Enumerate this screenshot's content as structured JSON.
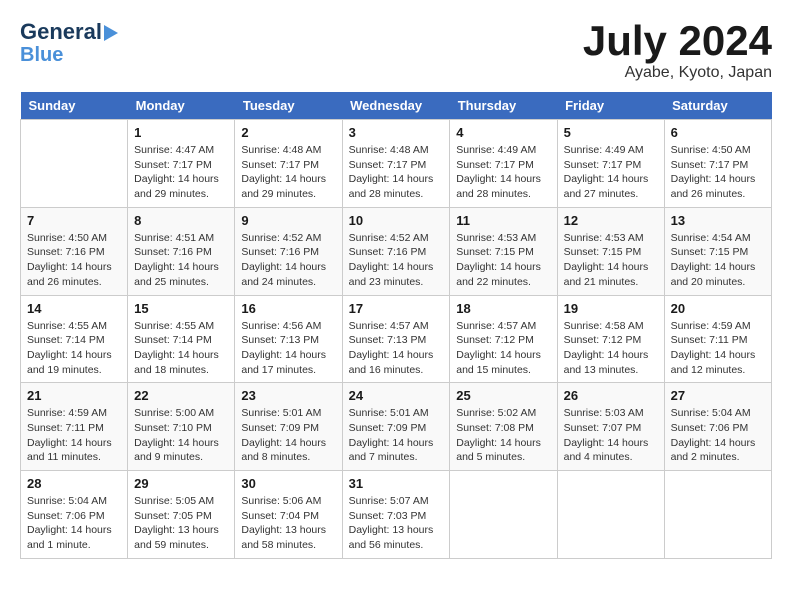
{
  "header": {
    "logo_line1": "General",
    "logo_line2": "Blue",
    "month": "July 2024",
    "location": "Ayabe, Kyoto, Japan"
  },
  "weekdays": [
    "Sunday",
    "Monday",
    "Tuesday",
    "Wednesday",
    "Thursday",
    "Friday",
    "Saturday"
  ],
  "weeks": [
    [
      {
        "day": "",
        "info": ""
      },
      {
        "day": "1",
        "info": "Sunrise: 4:47 AM\nSunset: 7:17 PM\nDaylight: 14 hours\nand 29 minutes."
      },
      {
        "day": "2",
        "info": "Sunrise: 4:48 AM\nSunset: 7:17 PM\nDaylight: 14 hours\nand 29 minutes."
      },
      {
        "day": "3",
        "info": "Sunrise: 4:48 AM\nSunset: 7:17 PM\nDaylight: 14 hours\nand 28 minutes."
      },
      {
        "day": "4",
        "info": "Sunrise: 4:49 AM\nSunset: 7:17 PM\nDaylight: 14 hours\nand 28 minutes."
      },
      {
        "day": "5",
        "info": "Sunrise: 4:49 AM\nSunset: 7:17 PM\nDaylight: 14 hours\nand 27 minutes."
      },
      {
        "day": "6",
        "info": "Sunrise: 4:50 AM\nSunset: 7:17 PM\nDaylight: 14 hours\nand 26 minutes."
      }
    ],
    [
      {
        "day": "7",
        "info": "Sunrise: 4:50 AM\nSunset: 7:16 PM\nDaylight: 14 hours\nand 26 minutes."
      },
      {
        "day": "8",
        "info": "Sunrise: 4:51 AM\nSunset: 7:16 PM\nDaylight: 14 hours\nand 25 minutes."
      },
      {
        "day": "9",
        "info": "Sunrise: 4:52 AM\nSunset: 7:16 PM\nDaylight: 14 hours\nand 24 minutes."
      },
      {
        "day": "10",
        "info": "Sunrise: 4:52 AM\nSunset: 7:16 PM\nDaylight: 14 hours\nand 23 minutes."
      },
      {
        "day": "11",
        "info": "Sunrise: 4:53 AM\nSunset: 7:15 PM\nDaylight: 14 hours\nand 22 minutes."
      },
      {
        "day": "12",
        "info": "Sunrise: 4:53 AM\nSunset: 7:15 PM\nDaylight: 14 hours\nand 21 minutes."
      },
      {
        "day": "13",
        "info": "Sunrise: 4:54 AM\nSunset: 7:15 PM\nDaylight: 14 hours\nand 20 minutes."
      }
    ],
    [
      {
        "day": "14",
        "info": "Sunrise: 4:55 AM\nSunset: 7:14 PM\nDaylight: 14 hours\nand 19 minutes."
      },
      {
        "day": "15",
        "info": "Sunrise: 4:55 AM\nSunset: 7:14 PM\nDaylight: 14 hours\nand 18 minutes."
      },
      {
        "day": "16",
        "info": "Sunrise: 4:56 AM\nSunset: 7:13 PM\nDaylight: 14 hours\nand 17 minutes."
      },
      {
        "day": "17",
        "info": "Sunrise: 4:57 AM\nSunset: 7:13 PM\nDaylight: 14 hours\nand 16 minutes."
      },
      {
        "day": "18",
        "info": "Sunrise: 4:57 AM\nSunset: 7:12 PM\nDaylight: 14 hours\nand 15 minutes."
      },
      {
        "day": "19",
        "info": "Sunrise: 4:58 AM\nSunset: 7:12 PM\nDaylight: 14 hours\nand 13 minutes."
      },
      {
        "day": "20",
        "info": "Sunrise: 4:59 AM\nSunset: 7:11 PM\nDaylight: 14 hours\nand 12 minutes."
      }
    ],
    [
      {
        "day": "21",
        "info": "Sunrise: 4:59 AM\nSunset: 7:11 PM\nDaylight: 14 hours\nand 11 minutes."
      },
      {
        "day": "22",
        "info": "Sunrise: 5:00 AM\nSunset: 7:10 PM\nDaylight: 14 hours\nand 9 minutes."
      },
      {
        "day": "23",
        "info": "Sunrise: 5:01 AM\nSunset: 7:09 PM\nDaylight: 14 hours\nand 8 minutes."
      },
      {
        "day": "24",
        "info": "Sunrise: 5:01 AM\nSunset: 7:09 PM\nDaylight: 14 hours\nand 7 minutes."
      },
      {
        "day": "25",
        "info": "Sunrise: 5:02 AM\nSunset: 7:08 PM\nDaylight: 14 hours\nand 5 minutes."
      },
      {
        "day": "26",
        "info": "Sunrise: 5:03 AM\nSunset: 7:07 PM\nDaylight: 14 hours\nand 4 minutes."
      },
      {
        "day": "27",
        "info": "Sunrise: 5:04 AM\nSunset: 7:06 PM\nDaylight: 14 hours\nand 2 minutes."
      }
    ],
    [
      {
        "day": "28",
        "info": "Sunrise: 5:04 AM\nSunset: 7:06 PM\nDaylight: 14 hours\nand 1 minute."
      },
      {
        "day": "29",
        "info": "Sunrise: 5:05 AM\nSunset: 7:05 PM\nDaylight: 13 hours\nand 59 minutes."
      },
      {
        "day": "30",
        "info": "Sunrise: 5:06 AM\nSunset: 7:04 PM\nDaylight: 13 hours\nand 58 minutes."
      },
      {
        "day": "31",
        "info": "Sunrise: 5:07 AM\nSunset: 7:03 PM\nDaylight: 13 hours\nand 56 minutes."
      },
      {
        "day": "",
        "info": ""
      },
      {
        "day": "",
        "info": ""
      },
      {
        "day": "",
        "info": ""
      }
    ]
  ]
}
